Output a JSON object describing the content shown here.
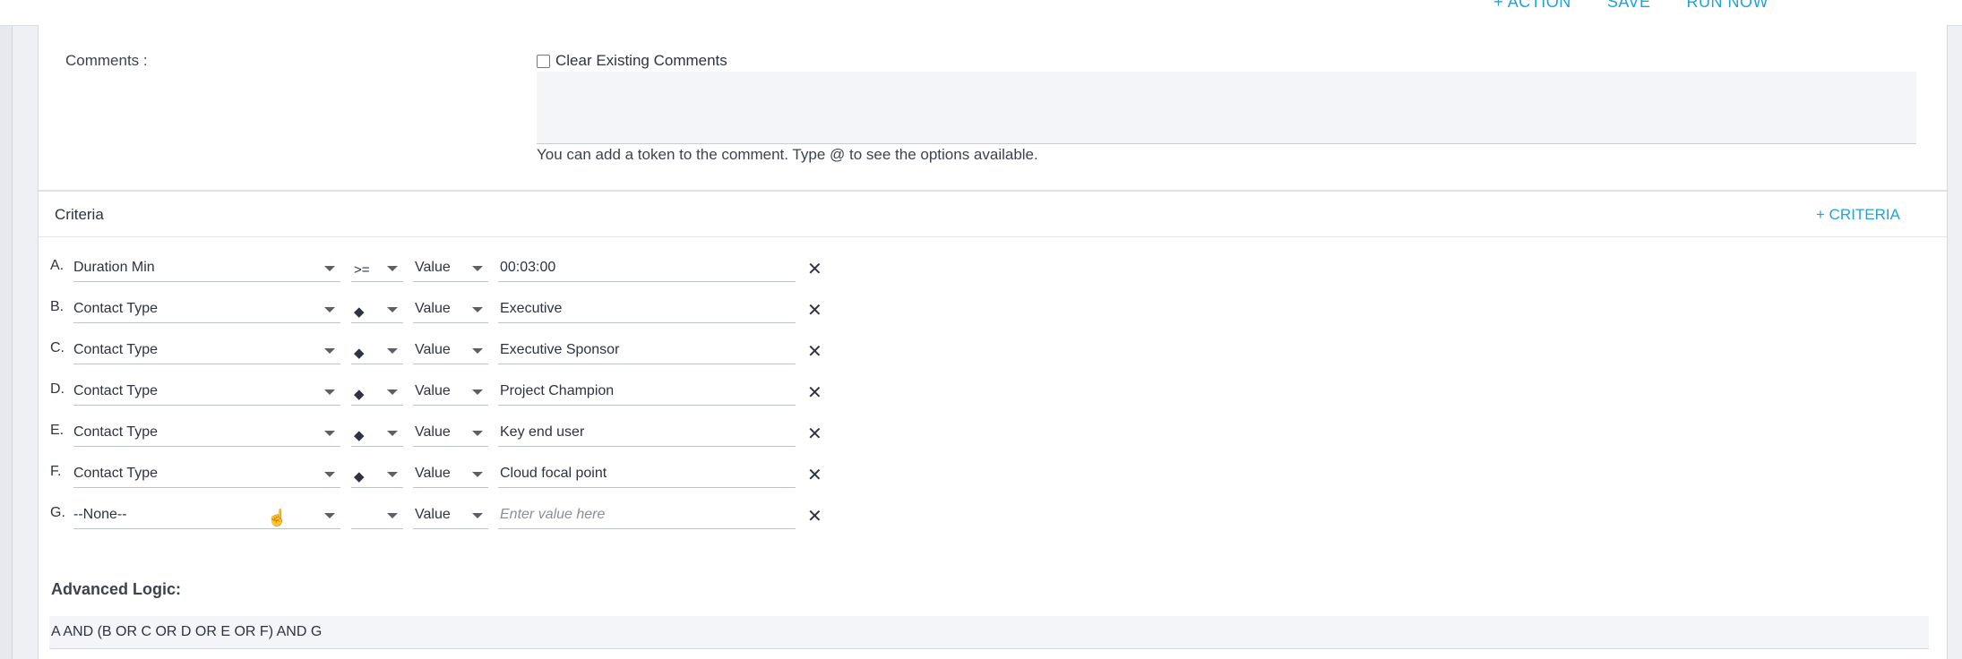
{
  "top_actions": [
    "+ ACTION",
    "SAVE",
    "RUN NOW"
  ],
  "comments": {
    "label": "Comments :",
    "clear_label": "Clear Existing Comments",
    "clear_checked": false,
    "value": "",
    "hint": "You can add a token to the comment. Type @ to see the options available."
  },
  "criteria": {
    "title": "Criteria",
    "add_label": "+ CRITERIA",
    "rows": [
      {
        "letter": "A.",
        "field": "Duration Min",
        "operator": ">=",
        "value_type": "Value",
        "value": "00:03:00",
        "placeholder": ""
      },
      {
        "letter": "B.",
        "field": "Contact Type",
        "operator": "◆",
        "value_type": "Value",
        "value": "Executive",
        "placeholder": ""
      },
      {
        "letter": "C.",
        "field": "Contact Type",
        "operator": "◆",
        "value_type": "Value",
        "value": "Executive Sponsor",
        "placeholder": ""
      },
      {
        "letter": "D.",
        "field": "Contact Type",
        "operator": "◆",
        "value_type": "Value",
        "value": "Project Champion",
        "placeholder": ""
      },
      {
        "letter": "E.",
        "field": "Contact Type",
        "operator": "◆",
        "value_type": "Value",
        "value": "Key end user",
        "placeholder": ""
      },
      {
        "letter": "F.",
        "field": "Contact Type",
        "operator": "◆",
        "value_type": "Value",
        "value": "Cloud focal point",
        "placeholder": ""
      },
      {
        "letter": "G.",
        "field": "--None--",
        "operator": "",
        "value_type": "Value",
        "value": "",
        "placeholder": "Enter value here"
      }
    ]
  },
  "advanced_logic": {
    "title": "Advanced Logic:",
    "value": "A AND (B OR C OR D OR E OR F) AND G"
  },
  "icons": {
    "remove": "close-icon",
    "dropdown": "chevron-down-icon",
    "cursor": "hand-pointer-icon"
  },
  "colors": {
    "accent": "#20a4d6"
  }
}
